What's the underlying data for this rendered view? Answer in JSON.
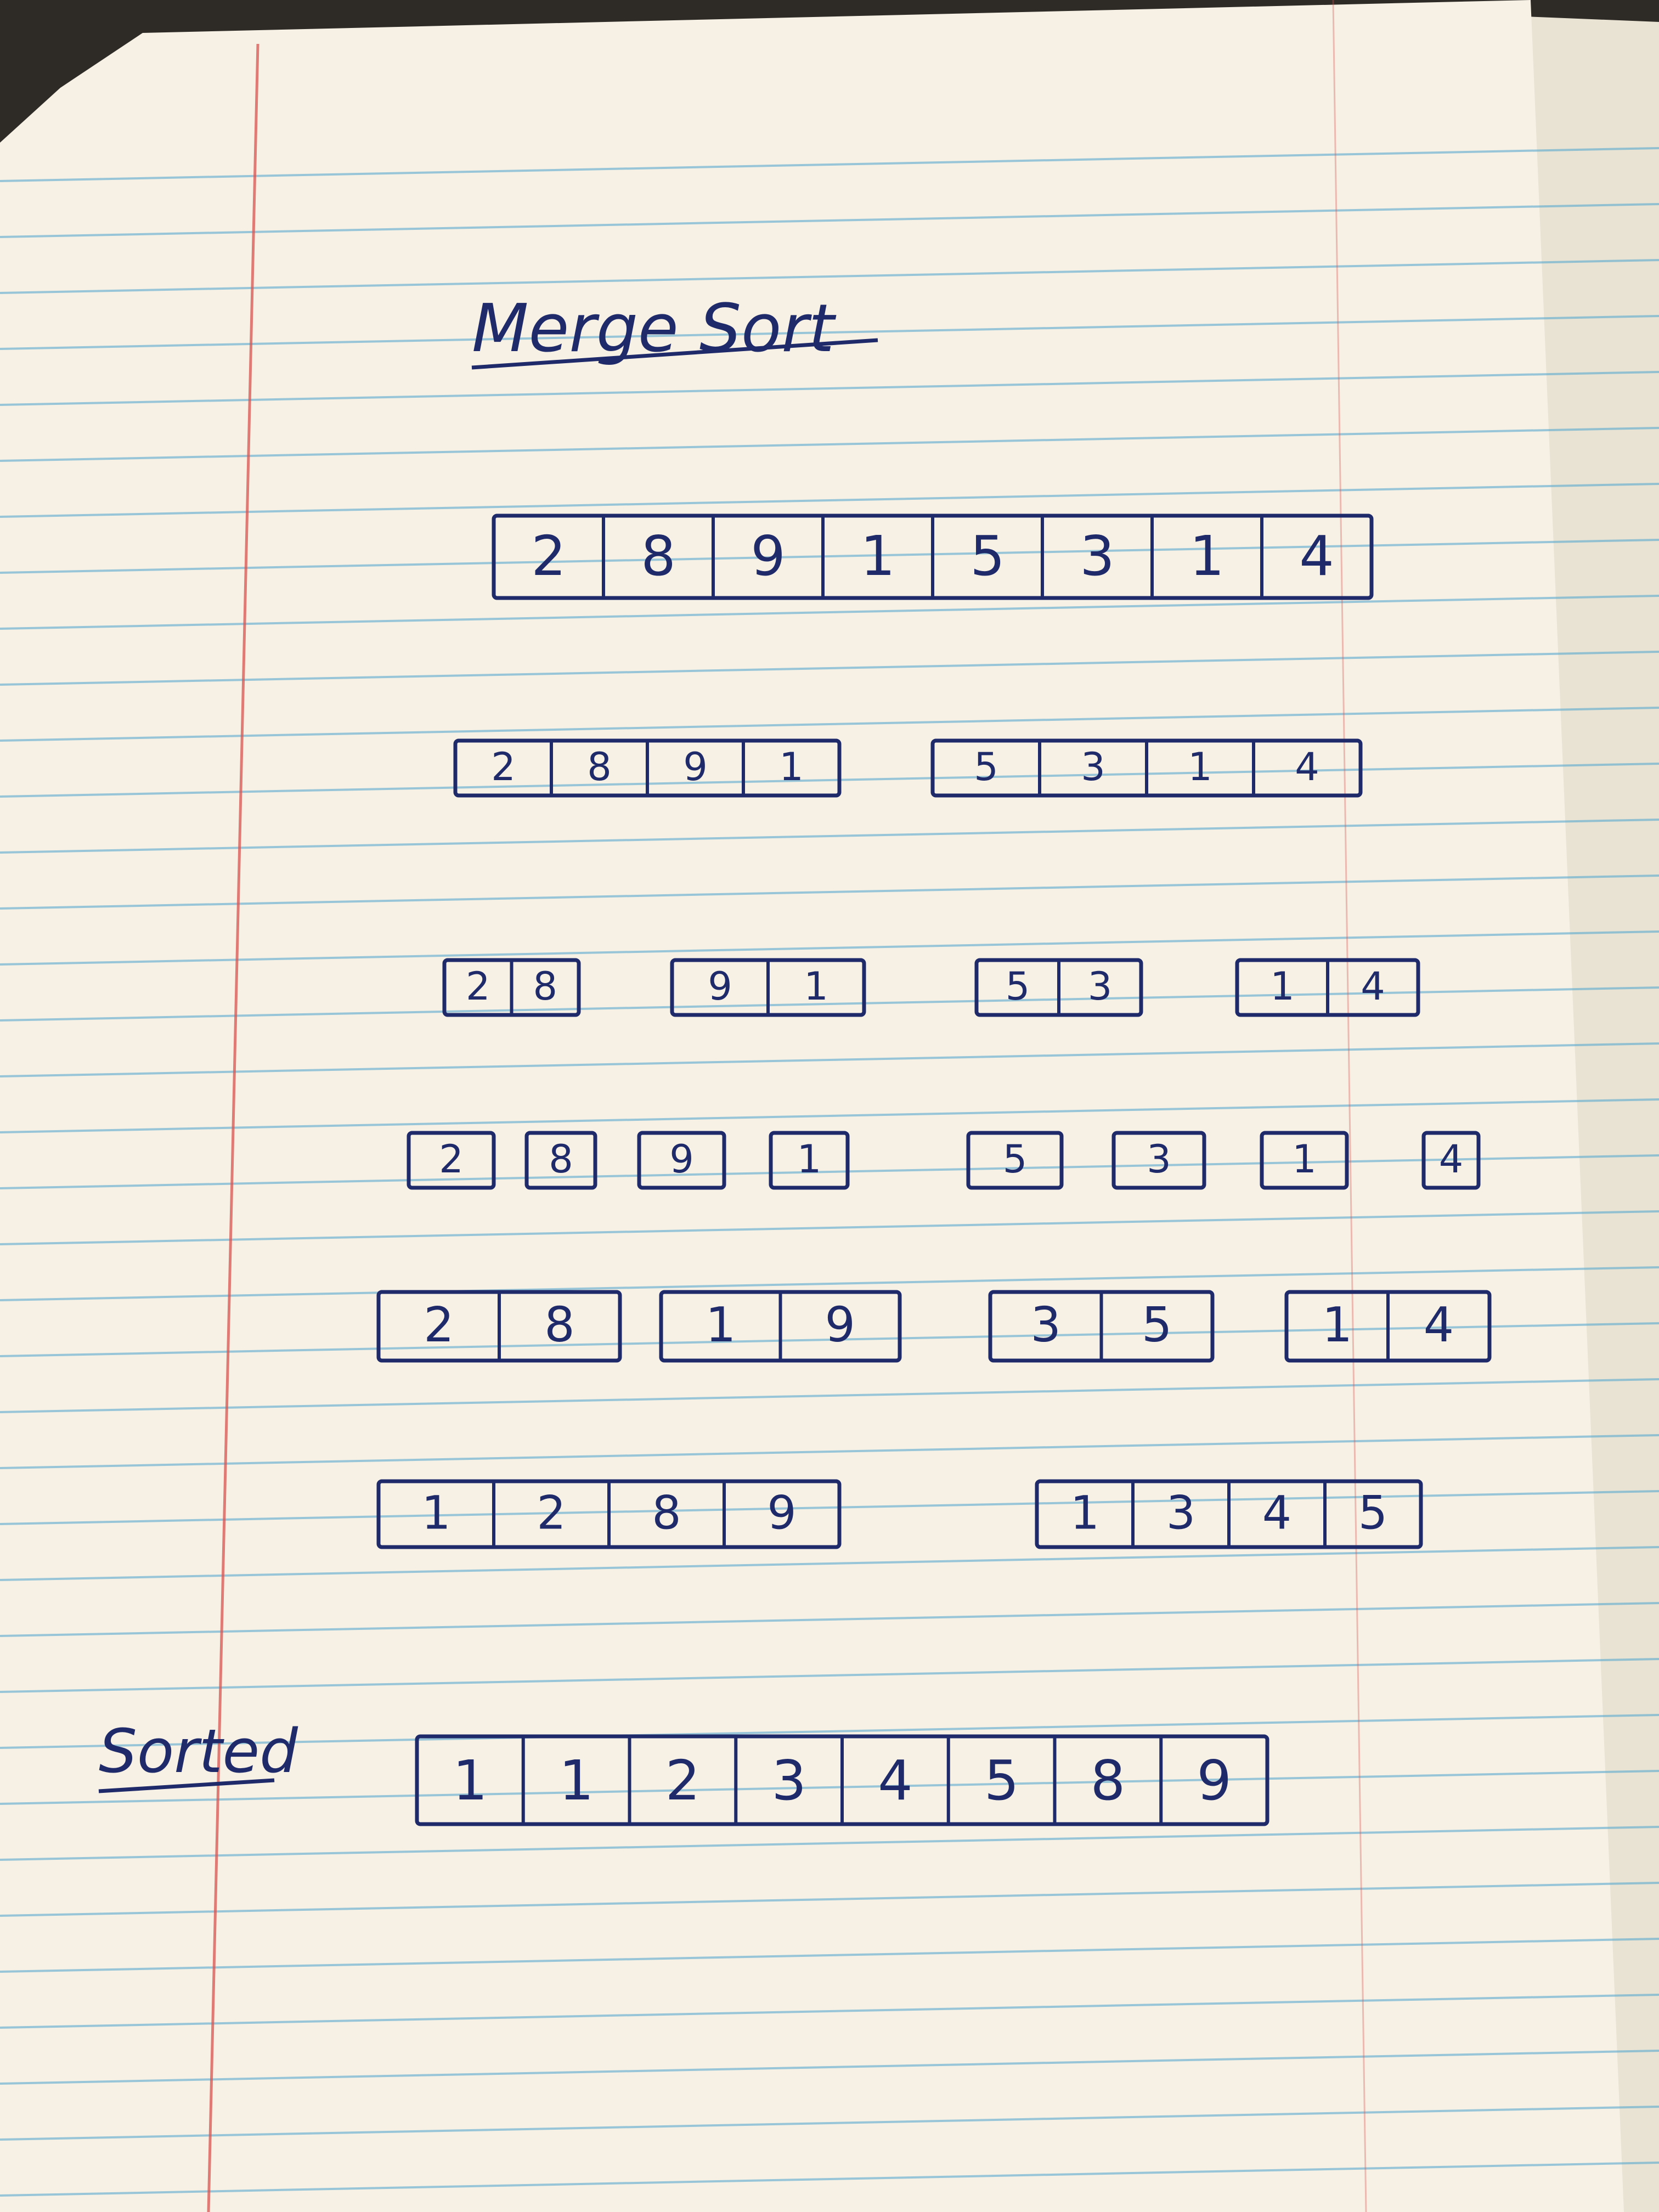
{
  "title": "Merge Sort",
  "sorted_label": "Sorted",
  "rows": [
    {
      "groups": [
        [
          "2",
          "8",
          "9",
          "1",
          "5",
          "3",
          "1",
          "4"
        ]
      ]
    },
    {
      "groups": [
        [
          "2",
          "8",
          "9",
          "1"
        ],
        [
          "5",
          "3",
          "1",
          "4"
        ]
      ]
    },
    {
      "groups": [
        [
          "2",
          "8"
        ],
        [
          "9",
          "1"
        ],
        [
          "5",
          "3"
        ],
        [
          "1",
          "4"
        ]
      ]
    },
    {
      "groups": [
        [
          "2"
        ],
        [
          "8"
        ],
        [
          "9"
        ],
        [
          "1"
        ],
        [
          "5"
        ],
        [
          "3"
        ],
        [
          "1"
        ],
        [
          "4"
        ]
      ]
    },
    {
      "groups": [
        [
          "2",
          "8"
        ],
        [
          "1",
          "9"
        ],
        [
          "3",
          "5"
        ],
        [
          "1",
          "4"
        ]
      ]
    },
    {
      "groups": [
        [
          "1",
          "2",
          "8",
          "9"
        ],
        [
          "1",
          "3",
          "4",
          "5"
        ]
      ]
    },
    {
      "groups": [
        [
          "1",
          "1",
          "2",
          "3",
          "4",
          "5",
          "8",
          "9"
        ]
      ]
    }
  ],
  "colors": {
    "ink": "#1f2a6b",
    "paper": "#f6f1e4",
    "rule": "#5aa9cf",
    "margin": "#d9534f"
  }
}
